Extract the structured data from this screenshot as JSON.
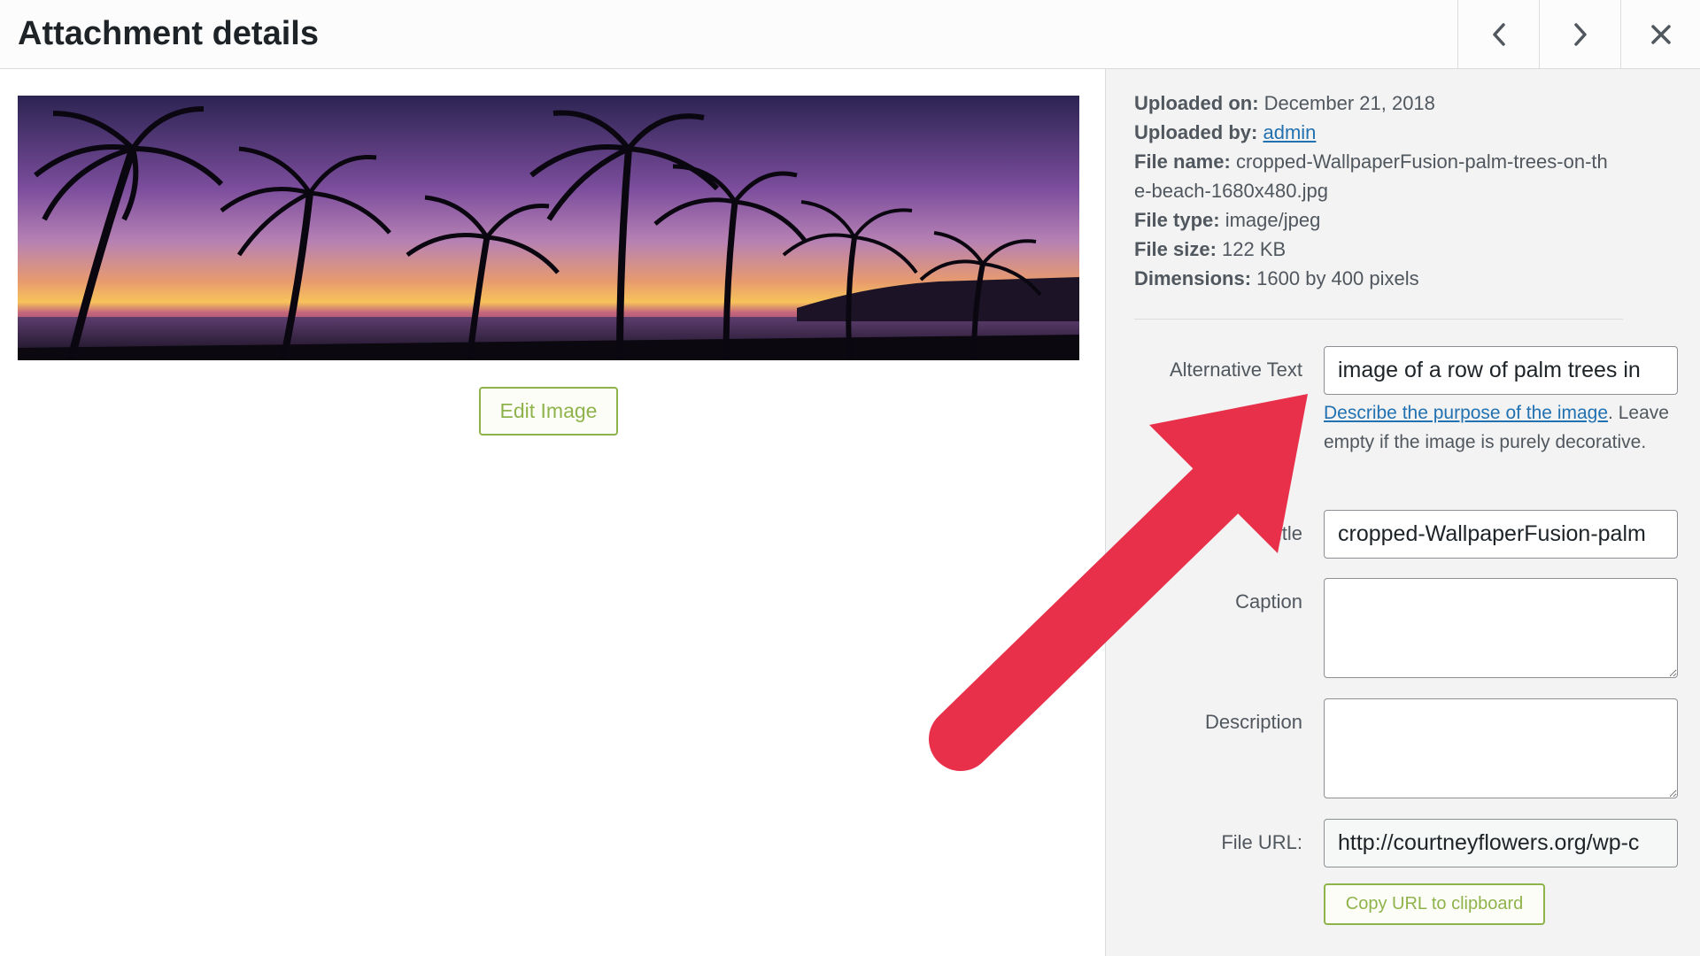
{
  "header": {
    "title": "Attachment details",
    "prev_icon": "chevron-left-icon",
    "next_icon": "chevron-right-icon",
    "close_icon": "close-icon"
  },
  "preview": {
    "edit_button_label": "Edit Image"
  },
  "details": {
    "uploaded_on": {
      "label": "Uploaded on:",
      "value": "December 21, 2018"
    },
    "uploaded_by": {
      "label": "Uploaded by:",
      "value": "admin"
    },
    "file_name": {
      "label": "File name:",
      "value": "cropped-WallpaperFusion-palm-trees-on-the-beach-1680x480.jpg"
    },
    "file_type": {
      "label": "File type:",
      "value": "image/jpeg"
    },
    "file_size": {
      "label": "File size:",
      "value": "122 KB"
    },
    "dimensions": {
      "label": "Dimensions:",
      "value": "1600 by 400 pixels"
    }
  },
  "form": {
    "alt_text": {
      "label": "Alternative Text",
      "value": "image of a row of palm trees in",
      "help_link": "Describe the purpose of the image",
      "help_suffix": ".",
      "help_rest": "Leave empty if the image is purely decorative."
    },
    "title": {
      "label": "Title",
      "value": "cropped-WallpaperFusion-palm"
    },
    "caption": {
      "label": "Caption",
      "value": ""
    },
    "description": {
      "label": "Description",
      "value": ""
    },
    "file_url": {
      "label": "File URL:",
      "value": "http://courtneyflowers.org/wp-c"
    },
    "copy_button_label": "Copy URL to clipboard"
  },
  "colors": {
    "accent_green": "#8fb34b",
    "link_blue": "#2271b1",
    "annotation_red": "#e8304a"
  }
}
